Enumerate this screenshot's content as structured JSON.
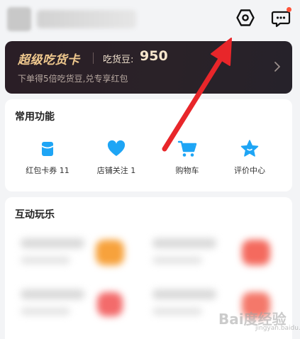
{
  "header": {
    "settings_icon": "settings-hex-icon",
    "messages_icon": "message-bubble-icon",
    "notification_dot_color": "#ff5339"
  },
  "foodie_card": {
    "title": "超级吃货卡",
    "beans_label": "吃货豆:",
    "beans_value": "950",
    "subtitle": "下单得5倍吃货豆,兑专享红包",
    "accent_color": "#f0c98e"
  },
  "common_functions": {
    "title": "常用功能",
    "items": [
      {
        "label": "红包卡券 11",
        "icon": "wallet-icon",
        "color": "#1ea5f5"
      },
      {
        "label": "店铺关注 1",
        "icon": "heart-icon",
        "color": "#1ea5f5"
      },
      {
        "label": "购物车",
        "icon": "cart-icon",
        "color": "#1ea5f5"
      },
      {
        "label": "评价中心",
        "icon": "star-face-icon",
        "color": "#1ea5f5"
      }
    ]
  },
  "interactive_fun": {
    "title": "互动玩乐"
  },
  "annotation": {
    "arrow_color": "#e8262a"
  },
  "watermark": {
    "text": "Bai度经验",
    "sub": "jingyan.baidu.com"
  }
}
